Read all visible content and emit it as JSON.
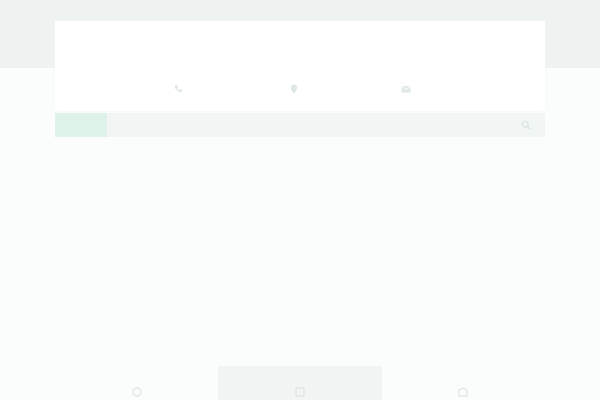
{
  "topbar": {
    "links": [
      "",
      ""
    ],
    "right_text": ""
  },
  "header": {
    "site_title": "",
    "contacts": [
      {
        "icon": "phone-icon",
        "line1": "",
        "line2": ""
      },
      {
        "icon": "location-pin-icon",
        "line1": "",
        "line2": ""
      },
      {
        "icon": "mail-icon",
        "line1": "",
        "line2": ""
      }
    ]
  },
  "nav": {
    "items": [
      "",
      "",
      "",
      "",
      ""
    ]
  },
  "tiles": [
    {
      "icon": "feature-icon"
    },
    {
      "icon": "feature-icon"
    },
    {
      "icon": "feature-icon"
    }
  ],
  "colors": {
    "accent": "#def2ea",
    "band": "#eef3f1",
    "text": "#b9c8c2"
  }
}
